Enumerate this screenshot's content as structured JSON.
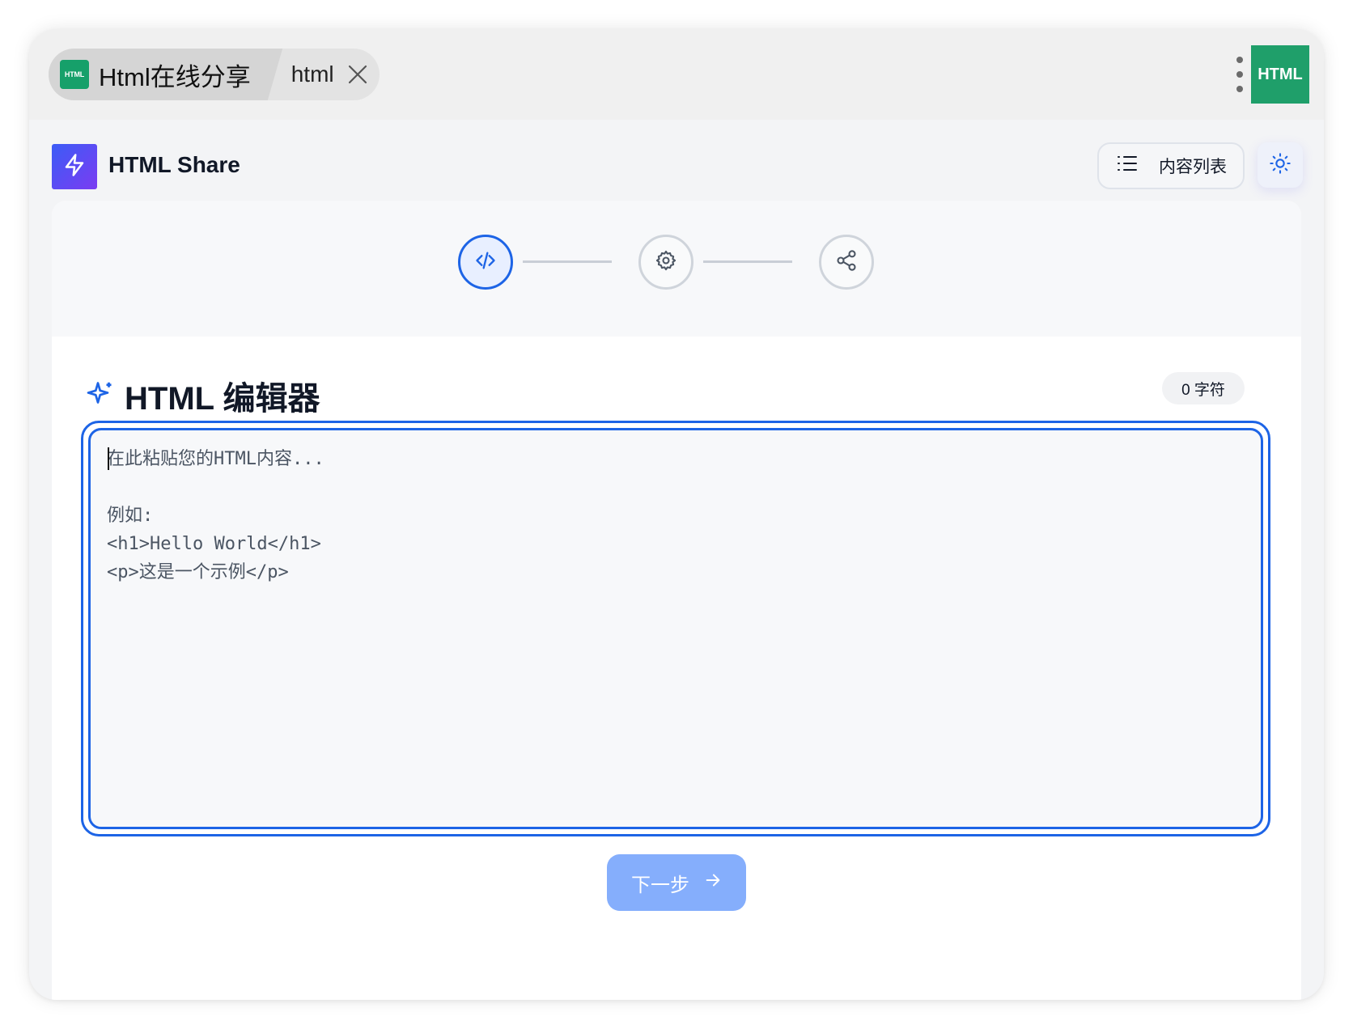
{
  "browser": {
    "tab_favicon_text": "HTML",
    "tab_title": "Html在线分享",
    "tab_secondary_title": "html",
    "extension_badge": "HTML"
  },
  "header": {
    "app_title": "HTML Share",
    "list_button_label": "内容列表",
    "logo_icon": "lightning-icon",
    "theme_icon": "sun-icon"
  },
  "stepper": {
    "steps": [
      {
        "icon": "code-icon",
        "active": true
      },
      {
        "icon": "gear-icon",
        "active": false
      },
      {
        "icon": "share-icon",
        "active": false
      }
    ]
  },
  "editor": {
    "title": "HTML 编辑器",
    "char_count": "0 字符",
    "value": "",
    "placeholder": "在此粘贴您的HTML内容...\n\n例如:\n<h1>Hello World</h1>\n<p>这是一个示例</p>"
  },
  "actions": {
    "next_label": "下一步"
  },
  "colors": {
    "accent": "#1d64e6",
    "next_button": "#85aefc",
    "badge_green": "#1f9f6a",
    "logo_gradient_start": "#3b5cf6",
    "logo_gradient_end": "#7b3cf2"
  }
}
